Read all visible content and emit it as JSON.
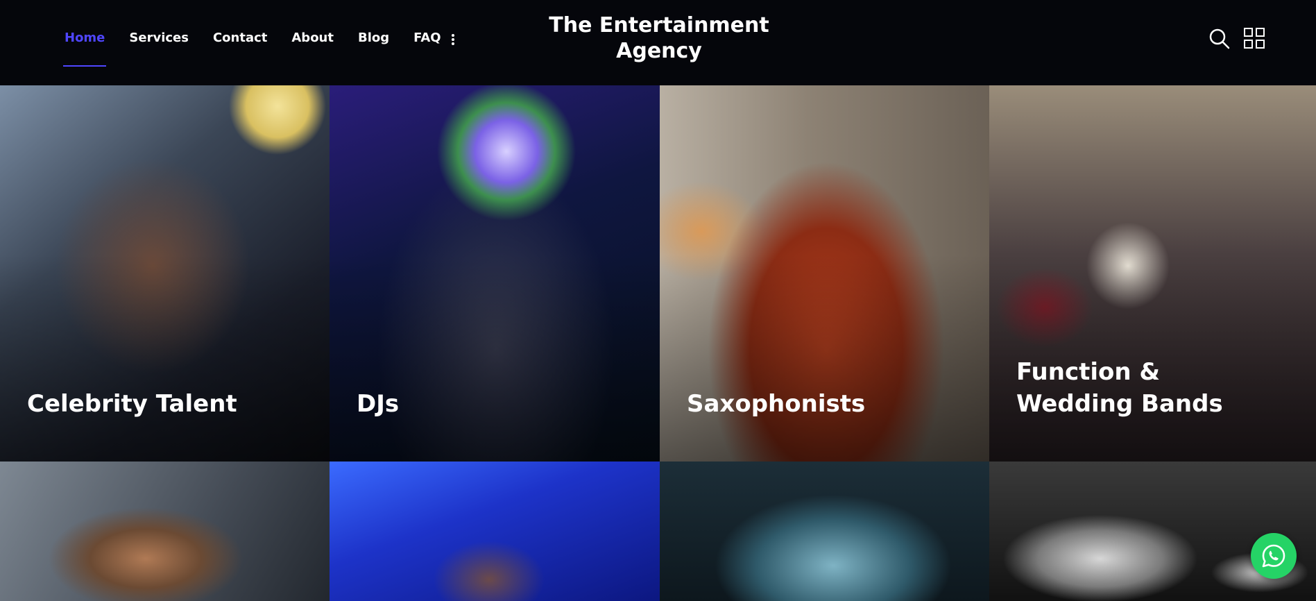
{
  "nav": {
    "items": [
      {
        "label": "Home",
        "active": true
      },
      {
        "label": "Services",
        "active": false
      },
      {
        "label": "Contact",
        "active": false
      },
      {
        "label": "About",
        "active": false
      },
      {
        "label": "Blog",
        "active": false
      },
      {
        "label": "FAQ",
        "active": false
      }
    ],
    "more_icon": "vertical-dots-icon"
  },
  "brand": {
    "title": "The Entertainment\nAgency"
  },
  "header_icons": {
    "search": "search-icon",
    "menu": "grid-menu-icon"
  },
  "services": [
    {
      "label": "Celebrity Talent"
    },
    {
      "label": "DJs"
    },
    {
      "label": "Saxophonists"
    },
    {
      "label": "Function & Wedding Bands"
    },
    {
      "label": ""
    },
    {
      "label": ""
    },
    {
      "label": ""
    },
    {
      "label": ""
    }
  ],
  "floating": {
    "whatsapp_icon": "whatsapp-icon"
  },
  "colors": {
    "background": "#05060b",
    "accent": "#4f46ff",
    "text": "#ffffff",
    "whatsapp": "#25d366"
  }
}
